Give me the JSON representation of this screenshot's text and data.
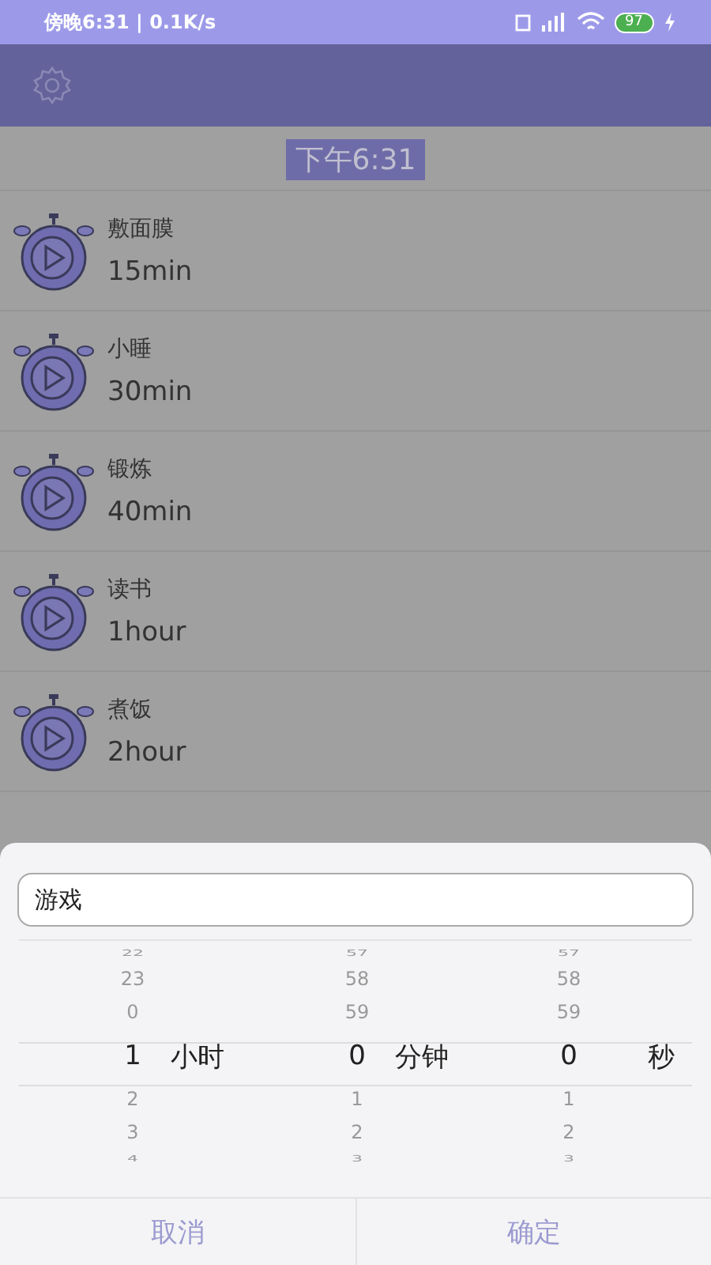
{
  "status_bar": {
    "text": "傍晚6:31 | 0.1K/s",
    "battery": "97"
  },
  "header": {
    "time": "下午6:31"
  },
  "timers": [
    {
      "name": "敷面膜",
      "duration": "15min"
    },
    {
      "name": "小睡",
      "duration": "30min"
    },
    {
      "name": "锻炼",
      "duration": "40min"
    },
    {
      "name": "读书",
      "duration": "1hour"
    },
    {
      "name": "煮饭",
      "duration": "2hour"
    }
  ],
  "dialog": {
    "name_field": {
      "value": "游戏"
    },
    "columns": [
      {
        "above": [
          "22",
          "23",
          "0"
        ],
        "value": "1",
        "unit": "小时",
        "below": [
          "2",
          "3",
          "4"
        ]
      },
      {
        "above": [
          "57",
          "58",
          "59"
        ],
        "value": "0",
        "unit": "分钟",
        "below": [
          "1",
          "2",
          "3"
        ]
      },
      {
        "above": [
          "57",
          "58",
          "59"
        ],
        "value": "0",
        "unit": "秒",
        "below": [
          "1",
          "2",
          "3"
        ]
      }
    ],
    "buttons": [
      "取消",
      "确定"
    ]
  }
}
